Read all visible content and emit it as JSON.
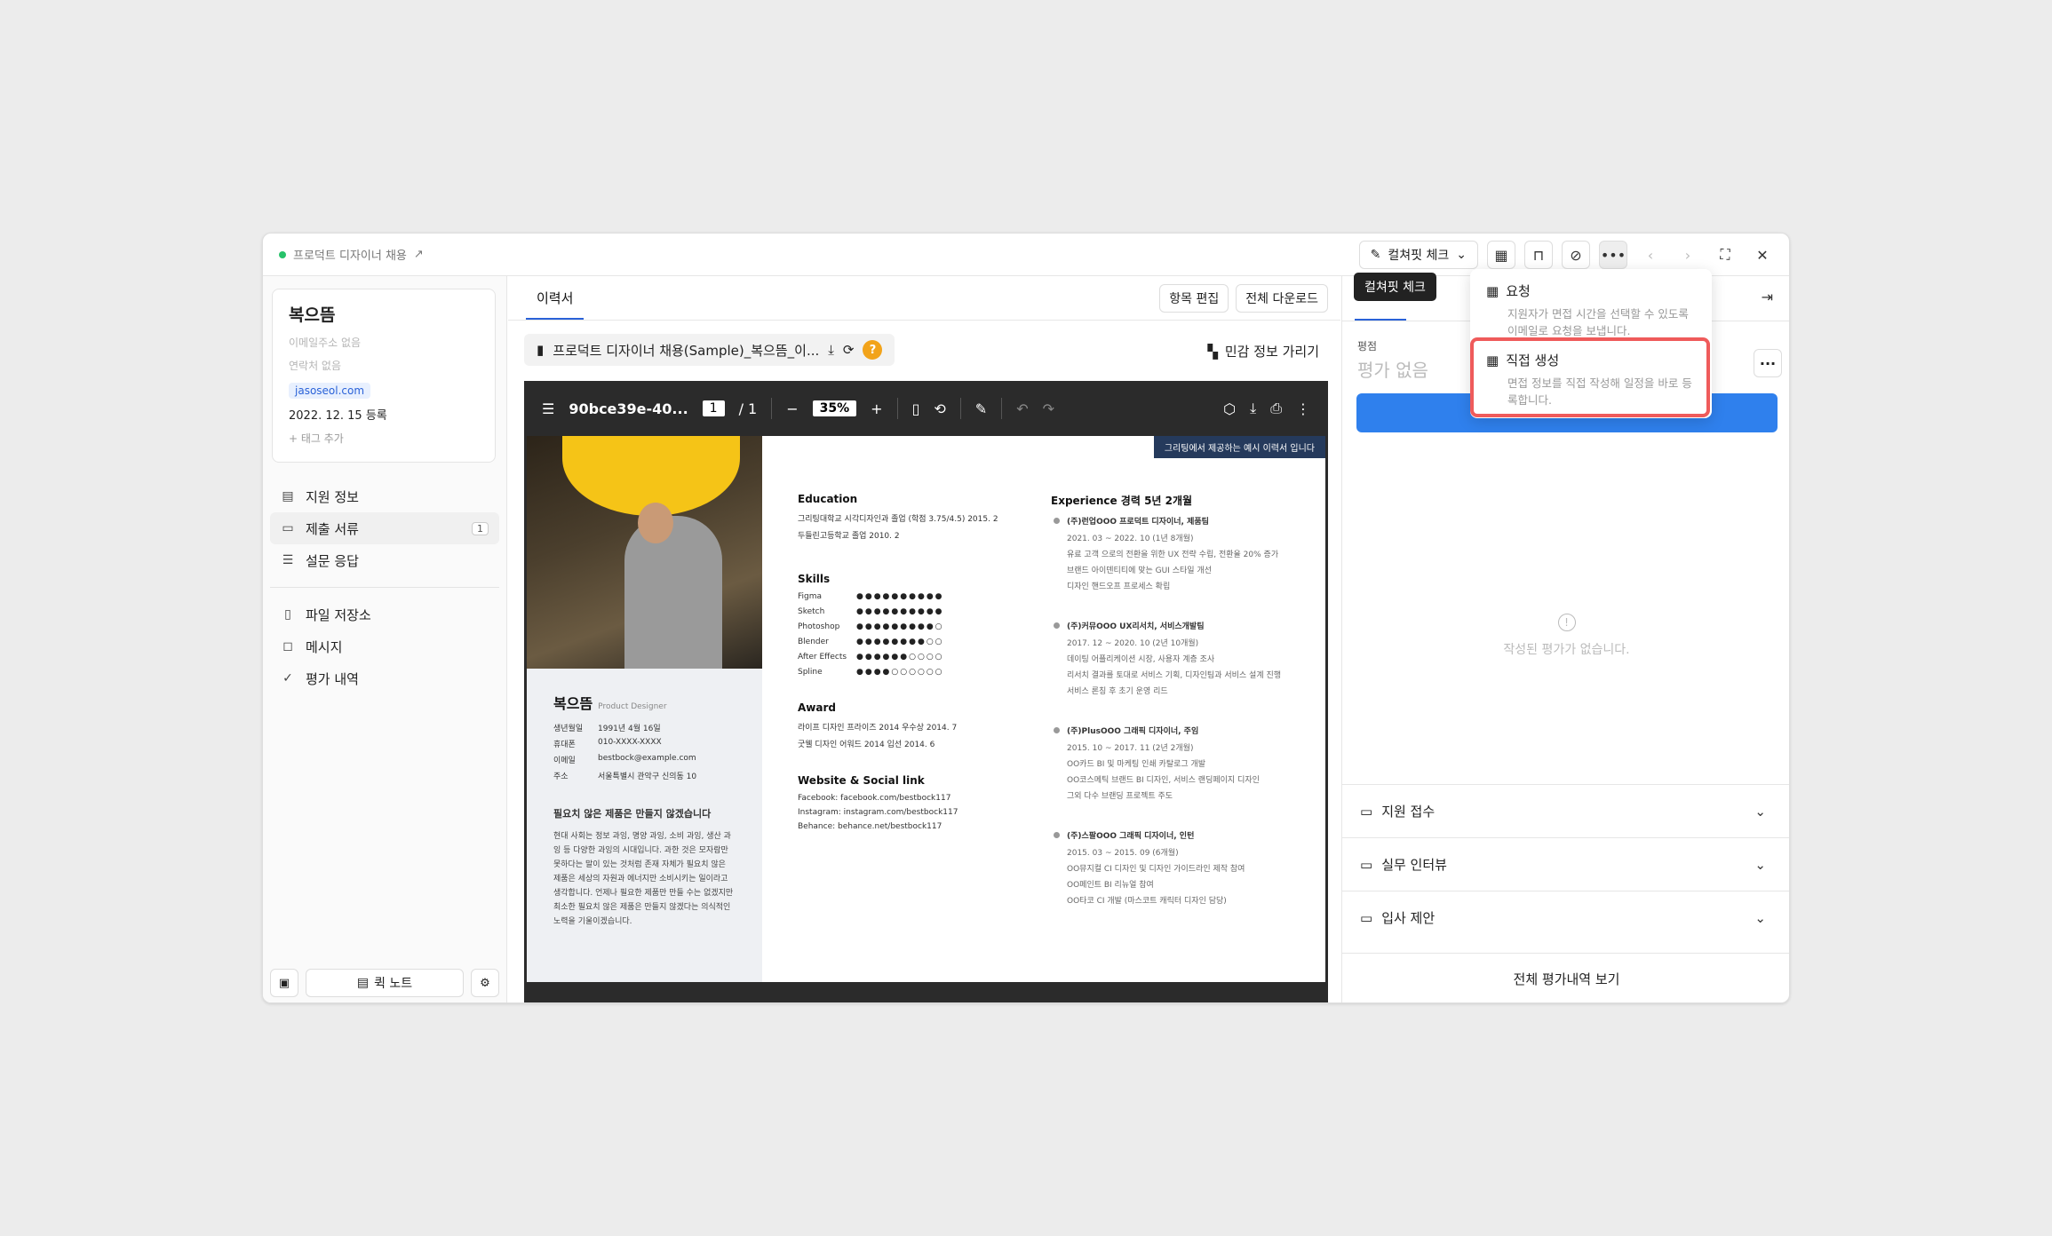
{
  "topbar": {
    "breadcrumb": "프로덕트 디자이너 채용",
    "dropdown_label": "컬쳐핏 체크"
  },
  "tooltip": "컬쳐핏 체크",
  "menu": {
    "items": [
      {
        "title": "요청",
        "desc": "지원자가 면접 시간을 선택할 수 있도록 이메일로 요청을 보냅니다."
      },
      {
        "title": "직접 생성",
        "desc": "면접 정보를 직접 작성해 일정을 바로 등록합니다."
      }
    ]
  },
  "candidate": {
    "name": "복으뜸",
    "email": "이메일주소 없음",
    "phone": "연락처 없음",
    "source": "jasoseol.com",
    "registered": "2022. 12. 15 등록",
    "add_tag": "+ 태그 추가"
  },
  "nav": {
    "items": [
      {
        "label": "지원 정보"
      },
      {
        "label": "제출 서류",
        "count": "1"
      },
      {
        "label": "설문 응답"
      },
      {
        "label": "파일 저장소"
      },
      {
        "label": "메시지"
      },
      {
        "label": "평가 내역"
      }
    ]
  },
  "quick_note": "퀵 노트",
  "center": {
    "tab": "이력서",
    "edit_btn": "항목 편집",
    "download_btn": "전체 다운로드",
    "file_name": "프로덕트 디자이너 채용(Sample)_복으뜸_이...",
    "privacy": "민감 정보 가리기"
  },
  "viewer": {
    "title": "90bce39e-40...",
    "page": "1",
    "pages": "/ 1",
    "zoom": "35%"
  },
  "resume": {
    "banner": "그리팅에서 제공하는 예시 이력서 입니다",
    "name": "복으뜸",
    "role": "Product Designer",
    "info": [
      {
        "k": "생년월일",
        "v": "1991년 4월 16일"
      },
      {
        "k": "휴대폰",
        "v": "010-XXXX-XXXX"
      },
      {
        "k": "이메일",
        "v": "bestbock@example.com"
      },
      {
        "k": "주소",
        "v": "서울특별시 관악구 신의동 10"
      }
    ],
    "motto": "필요치 않은 제품은 만들지 않겠습니다",
    "about": "현대 사회는 정보 과잉, 명양 과잉, 소비 과잉, 생산 과잉 등 다양한 과잉의 시대입니다. 과한 것은 모자람만 못하다는 말이 있는 것처럼 존재 자체가 필요치 않은 제품은 세상의 자원과 에너지만 소비시키는 일이라고 생각합니다. 언제나 필요한 제품만 만들 수는 없겠지만 최소한 필요치 않은 제품은 만들지 않겠다는 의식적인 노력을 기울이겠습니다.",
    "education_title": "Education",
    "education": [
      "그리팅대학교 시각디자인과 졸업 (학점 3.75/4.5)  2015. 2",
      "두들린고등학교 졸업  2010. 2"
    ],
    "skills_title": "Skills",
    "skills": [
      {
        "k": "Figma",
        "v": "●●●●●●●●●●"
      },
      {
        "k": "Sketch",
        "v": "●●●●●●●●●●"
      },
      {
        "k": "Photoshop",
        "v": "●●●●●●●●●○"
      },
      {
        "k": "Blender",
        "v": "●●●●●●●●○○"
      },
      {
        "k": "After Effects",
        "v": "●●●●●●○○○○"
      },
      {
        "k": "Spline",
        "v": "●●●●○○○○○○"
      }
    ],
    "award_title": "Award",
    "awards": [
      "라이프 디자인 프라이즈 2014 우수상  2014. 7",
      "굿웰 디자인 어워드 2014 입선  2014. 6"
    ],
    "web_title": "Website & Social link",
    "links": [
      "Facebook: facebook.com/bestbock117",
      "Instagram: instagram.com/bestbock117",
      "Behance: behance.net/bestbock117"
    ],
    "exp_title": "Experience  경력 5년 2개월",
    "experience": [
      {
        "h": "(주)런업OOO 프로덕트 디자이너, 제품팀",
        "d": "2021. 03 ~ 2022. 10 (1년 8개월)",
        "l": [
          "유료 고객 으로의 전환을 위한 UX 전략 수립, 전환율 20% 증가",
          "브랜드 아이덴티티에 맞는 GUI 스타일 개선",
          "디자인 핸드오프 프로세스 확립"
        ]
      },
      {
        "h": "(주)커뮤OOO UX리서치, 서비스개발팀",
        "d": "2017. 12 ~ 2020. 10 (2년 10개월)",
        "l": [
          "데이팅 어플리케이션 시장, 사용자 계층 조사",
          "리서치 결과를 토대로 서비스 기획, 디자인팀과 서비스 설계 진행",
          "서비스 론칭 후 초기 운영 리드"
        ]
      },
      {
        "h": "(주)PlusOOO 그래픽 디자이너, 주임",
        "d": "2015. 10 ~ 2017. 11 (2년 2개월)",
        "l": [
          "OO카드 BI 및 마케팅 인쇄 카탈로그 개발",
          "OO코스메틱 브랜드 BI 디자인, 서비스 랜딩페이지 디자인",
          "그외 다수 브랜딩 프로젝트 주도"
        ]
      },
      {
        "h": "(주)스팔OOO 그래픽 디자이너, 인턴",
        "d": "2015. 03 ~ 2015. 09 (6개월)",
        "l": [
          "OO뮤지컬 CI 디자인 및 디자인 가이드라인 제작 참여",
          "OO페인트 BI 리뉴얼 참여",
          "OO타코 CI 개발 (마스코트 캐릭터 디자인 담당)"
        ]
      }
    ]
  },
  "right": {
    "rating_label": "평점",
    "rating_value": "평가 없음",
    "empty": "작성된 평가가 없습니다.",
    "sections": [
      "지원 접수",
      "실무 인터뷰",
      "입사 제안"
    ],
    "all_reviews": "전체 평가내역 보기"
  }
}
